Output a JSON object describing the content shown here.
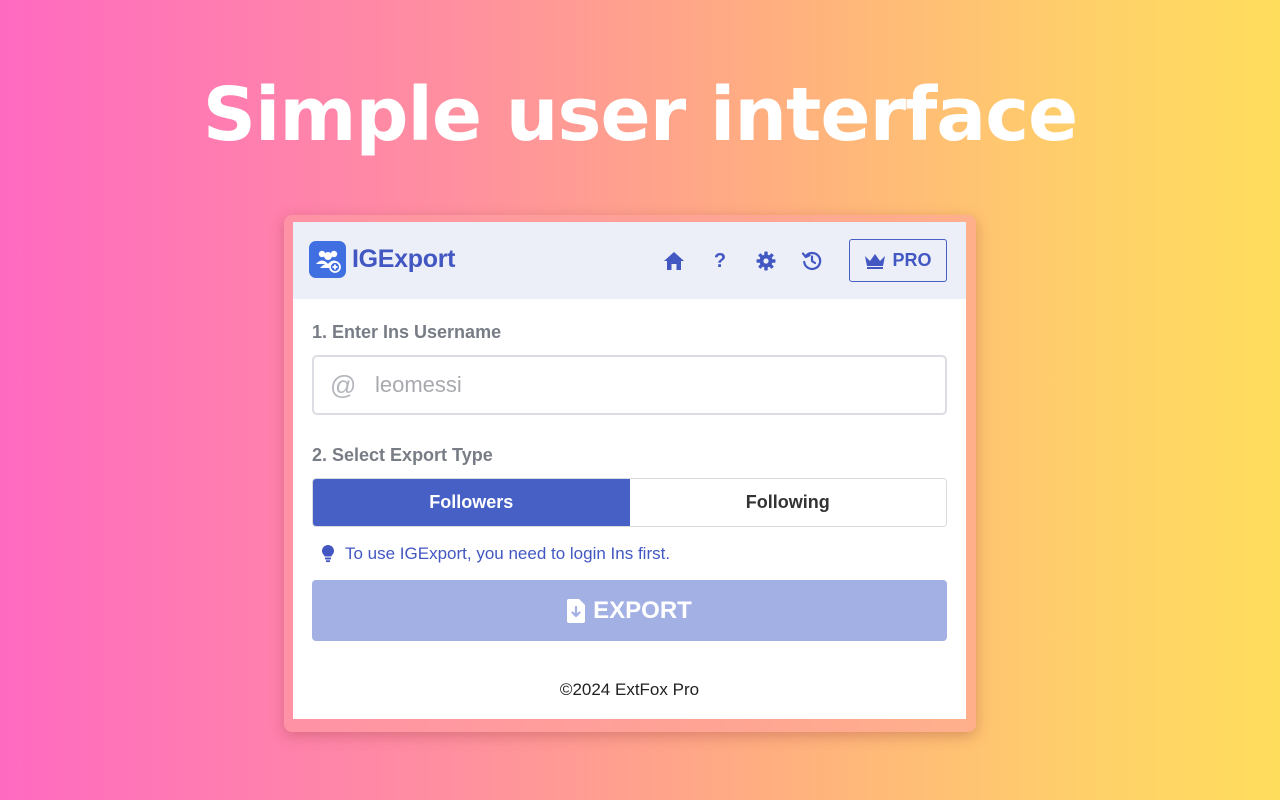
{
  "headline": "Simple user interface",
  "app": {
    "name": "IGExport",
    "accent_color": "#4760c6",
    "header_bg": "#eceff8"
  },
  "nav": {
    "icons": [
      "home-icon",
      "help-icon",
      "settings-icon",
      "history-icon"
    ],
    "help_glyph": "?",
    "pro_label": "PRO"
  },
  "step1": {
    "label": "1. Enter Ins Username",
    "at_symbol": "@",
    "placeholder": "leomessi",
    "value": ""
  },
  "step2": {
    "label": "2. Select Export Type",
    "options": [
      "Followers",
      "Following"
    ],
    "selected": "Followers"
  },
  "hint": "To use IGExport, you need to login Ins first.",
  "export_label": "EXPORT",
  "footer": "©2024 ExtFox Pro"
}
